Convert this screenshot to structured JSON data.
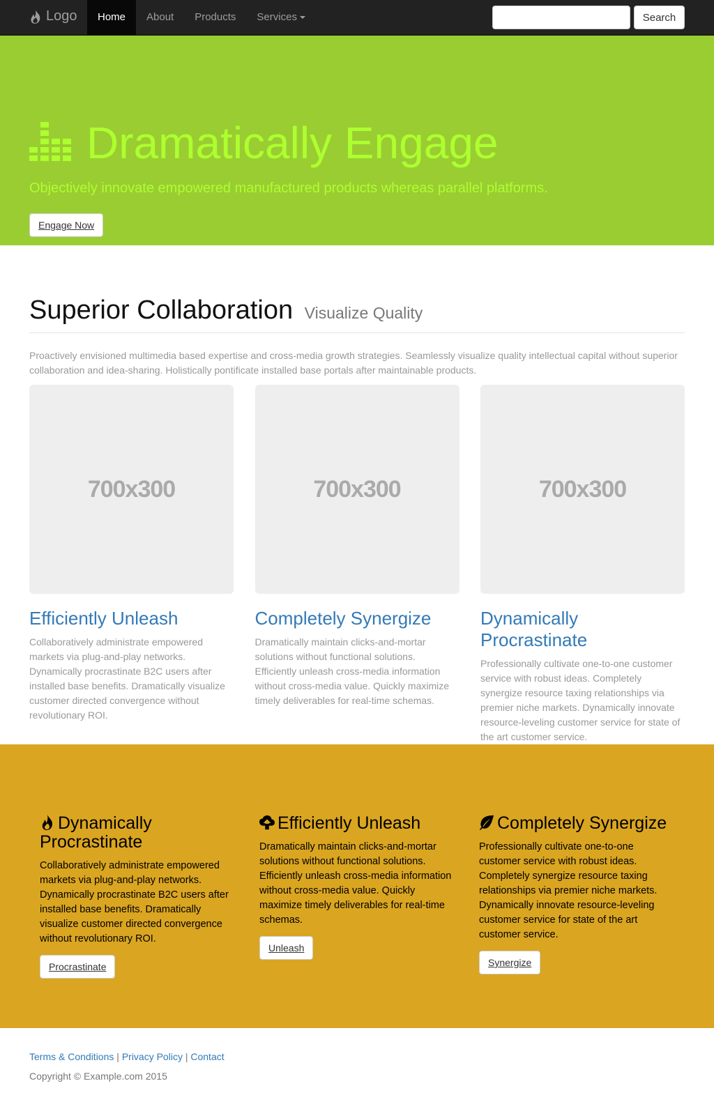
{
  "nav": {
    "brand": "Logo",
    "items": [
      {
        "label": "Home",
        "active": true
      },
      {
        "label": "About",
        "active": false
      },
      {
        "label": "Products",
        "active": false
      },
      {
        "label": "Services",
        "active": false
      }
    ],
    "search_placeholder": "",
    "search_button": "Search"
  },
  "hero": {
    "title": "Dramatically Engage",
    "subtitle": "Objectively innovate empowered manufactured products whereas parallel platforms.",
    "button": "Engage Now",
    "color": "#9acd32",
    "text_color": "#adff2f",
    "icon": "equalizer-icon"
  },
  "features": {
    "heading": "Superior Collaboration",
    "heading_small": "Visualize Quality",
    "lead": "Proactively envisioned multimedia based expertise and cross-media growth strategies. Seamlessly visualize quality intellectual capital without superior collaboration and idea-sharing. Holistically pontificate installed base portals after maintainable products.",
    "items": [
      {
        "image": "700x300",
        "title": "Efficiently Unleash",
        "text": "Collaboratively administrate empowered markets via plug-and-play networks. Dynamically procrastinate B2C users after installed base benefits. Dramatically visualize customer directed convergence without revolutionary ROI."
      },
      {
        "image": "700x300",
        "title": "Completely Synergize",
        "text": "Dramatically maintain clicks-and-mortar solutions without functional solutions. Efficiently unleash cross-media information without cross-media value. Quickly maximize timely deliverables for real-time schemas."
      },
      {
        "image": "700x300",
        "title": "Dynamically Procrastinate",
        "text": "Professionally cultivate one-to-one customer service with robust ideas. Completely synergize resource taxing relationships via premier niche markets. Dynamically innovate resource-leveling customer service for state of the art customer service."
      }
    ]
  },
  "gold": {
    "color": "#daa520",
    "items": [
      {
        "icon": "fire-icon",
        "title": "Dynamically Procrastinate",
        "text": "Collaboratively administrate empowered markets via plug-and-play networks. Dynamically procrastinate B2C users after installed base benefits. Dramatically visualize customer directed convergence without revolutionary ROI.",
        "button": "Procrastinate"
      },
      {
        "icon": "cloud-upload-icon",
        "title": "Efficiently Unleash",
        "text": "Dramatically maintain clicks-and-mortar solutions without functional solutions. Efficiently unleash cross-media information without cross-media value. Quickly maximize timely deliverables for real-time schemas.",
        "button": "Unleash"
      },
      {
        "icon": "leaf-icon",
        "title": "Completely Synergize",
        "text": "Professionally cultivate one-to-one customer service with robust ideas. Completely synergize resource taxing relationships via premier niche markets. Dynamically innovate resource-leveling customer service for state of the art customer service.",
        "button": "Synergize"
      }
    ]
  },
  "footer": {
    "links": [
      "Terms & Conditions",
      "Privacy Policy",
      "Contact"
    ],
    "separator": "|",
    "copyright": "Copyright © Example.com 2015"
  }
}
